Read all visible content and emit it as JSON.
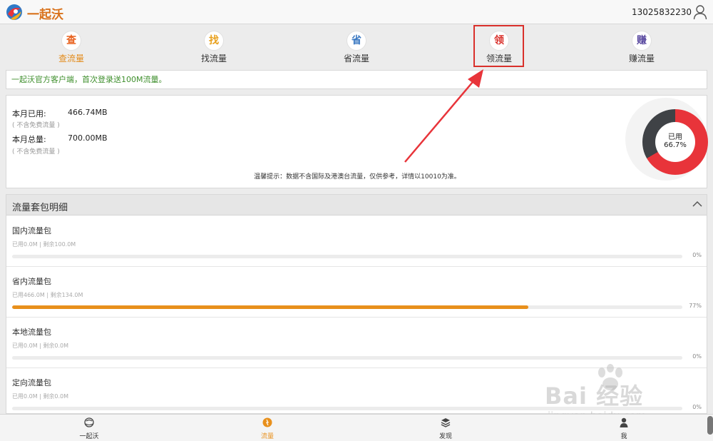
{
  "header": {
    "logo_text": "一起沃",
    "phone": "13025832230",
    "brand_color": "#d9721c"
  },
  "topnav": {
    "items": [
      {
        "icon_char": "查",
        "label": "查流量",
        "color": "#e8601c",
        "active": true
      },
      {
        "icon_char": "找",
        "label": "找流量",
        "color": "#e8a01c",
        "active": false
      },
      {
        "icon_char": "省",
        "label": "省流量",
        "color": "#3a78c2",
        "active": false
      },
      {
        "icon_char": "领",
        "label": "领流量",
        "color": "#d9302b",
        "active": false
      },
      {
        "icon_char": "赚",
        "label": "赚流量",
        "color": "#5a4aa0",
        "active": false
      }
    ]
  },
  "notice": "一起沃官方客户端，首次登录送100M流量。",
  "usage": {
    "used_label": "本月已用:",
    "used_value": "466.74MB",
    "used_note": "( 不含免费流量 )",
    "total_label": "本月总量:",
    "total_value": "700.00MB",
    "total_note": "( 不含免费流量 )",
    "tip": "温馨提示：数据不含国际及港澳台流量，仅供参考，详情以10010为准。",
    "donut": {
      "label": "已用",
      "percent_text": "66.7%",
      "fraction": 0.667,
      "used_color": "#e8343a",
      "rest_color": "#3f4246"
    }
  },
  "packages": {
    "title": "流量套包明细",
    "rows": [
      {
        "name": "国内流量包",
        "meta": "已用0.0M | 剩余100.0M",
        "percent": 0,
        "percent_text": "0%"
      },
      {
        "name": "省内流量包",
        "meta": "已用466.0M | 剩余134.0M",
        "percent": 77,
        "percent_text": "77%"
      },
      {
        "name": "本地流量包",
        "meta": "已用0.0M | 剩余0.0M",
        "percent": 0,
        "percent_text": "0%"
      },
      {
        "name": "定向流量包",
        "meta": "已用0.0M | 剩余0.0M",
        "percent": 0,
        "percent_text": "0%"
      }
    ]
  },
  "tabbar": {
    "items": [
      {
        "icon": "globe-icon",
        "label": "一起沃",
        "active": false
      },
      {
        "icon": "traffic-icon",
        "label": "流量",
        "active": true
      },
      {
        "icon": "discover-icon",
        "label": "发现",
        "active": false
      },
      {
        "icon": "person-icon",
        "label": "我",
        "active": false
      }
    ]
  },
  "watermark": {
    "text": "Bai 经验",
    "url": "jingyan.baidu.com"
  }
}
